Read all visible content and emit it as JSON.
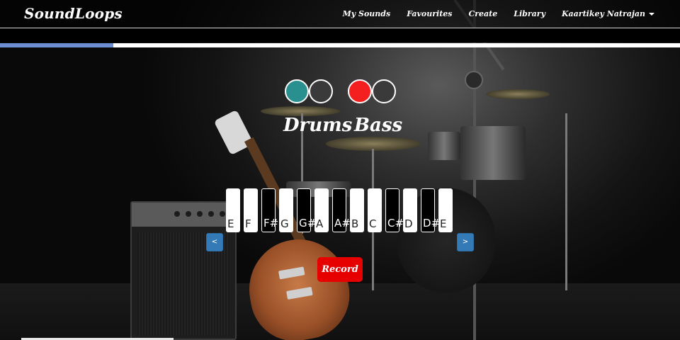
{
  "app": {
    "brand": "SoundLoops"
  },
  "nav": {
    "links": [
      "My Sounds",
      "Favourites",
      "Create",
      "Library"
    ],
    "user": "Kaartikey Natrajan"
  },
  "progress": {
    "fraction": 0.167,
    "fill_color": "#6c8fd4"
  },
  "instruments": [
    {
      "label": "Drums",
      "colors": [
        "#2a8f8f",
        "#3a3a3a"
      ]
    },
    {
      "label": "Bass",
      "colors": [
        "#f41f1f",
        "#3a3a3a"
      ]
    }
  ],
  "keyboard": {
    "keys": [
      {
        "note": "E",
        "type": "white"
      },
      {
        "note": "F",
        "type": "white"
      },
      {
        "note": "F#",
        "type": "black"
      },
      {
        "note": "G",
        "type": "white"
      },
      {
        "note": "G#",
        "type": "black"
      },
      {
        "note": "A",
        "type": "white"
      },
      {
        "note": "A#",
        "type": "black"
      },
      {
        "note": "B",
        "type": "white"
      },
      {
        "note": "C",
        "type": "white"
      },
      {
        "note": "C#",
        "type": "black"
      },
      {
        "note": "D",
        "type": "white"
      },
      {
        "note": "D#",
        "type": "black"
      },
      {
        "note": "E",
        "type": "white"
      }
    ],
    "prev_label": "<",
    "next_label": ">"
  },
  "record": {
    "label": "Record",
    "color": "#e60000"
  },
  "colors": {
    "accent_blue": "#337ab7"
  }
}
